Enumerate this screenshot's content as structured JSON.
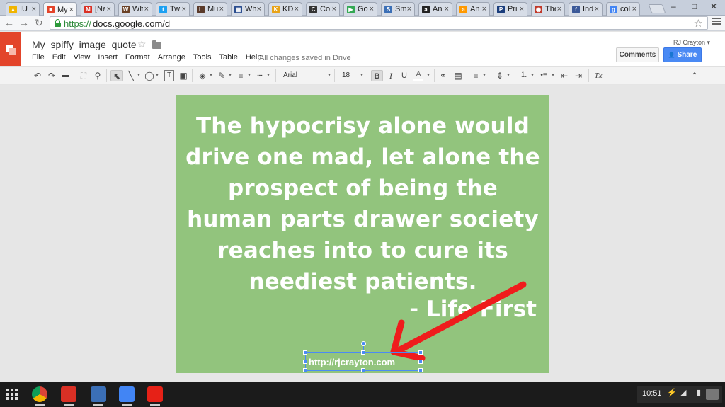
{
  "browser": {
    "tabs": [
      {
        "label": "IU",
        "fav_color": "#f0b400",
        "fav_glyph": "▲"
      },
      {
        "label": "My",
        "fav_color": "#e3442a",
        "fav_glyph": "■",
        "active": true
      },
      {
        "label": "[Ne",
        "fav_color": "#d93025",
        "fav_glyph": "M"
      },
      {
        "label": "Wh",
        "fav_color": "#6b4226",
        "fav_glyph": "W"
      },
      {
        "label": "Tw",
        "fav_color": "#1da1f2",
        "fav_glyph": "t"
      },
      {
        "label": "Mu",
        "fav_color": "#5a3a2a",
        "fav_glyph": "L"
      },
      {
        "label": "Wh",
        "fav_color": "#2a4d8f",
        "fav_glyph": "▦"
      },
      {
        "label": "KD",
        "fav_color": "#e8a317",
        "fav_glyph": "K"
      },
      {
        "label": "Co",
        "fav_color": "#333333",
        "fav_glyph": "C"
      },
      {
        "label": "Go",
        "fav_color": "#34a853",
        "fav_glyph": "▶"
      },
      {
        "label": "Sm",
        "fav_color": "#3b6fb6",
        "fav_glyph": "S"
      },
      {
        "label": "An",
        "fav_color": "#222222",
        "fav_glyph": "a"
      },
      {
        "label": "An",
        "fav_color": "#ff9900",
        "fav_glyph": "a"
      },
      {
        "label": "Pri",
        "fav_color": "#1a3d7c",
        "fav_glyph": "P"
      },
      {
        "label": "The",
        "fav_color": "#c0392b",
        "fav_glyph": "◉"
      },
      {
        "label": "Ind",
        "fav_color": "#3b5998",
        "fav_glyph": "f"
      },
      {
        "label": "col",
        "fav_color": "#4285f4",
        "fav_glyph": "g"
      }
    ],
    "tab_close": "×",
    "url_https": "https://",
    "url_rest": "docs.google.com/d",
    "back": "←",
    "forward": "→",
    "reload": "↻",
    "star": "☆",
    "win_min": "–",
    "win_max": "□",
    "win_close": "✕"
  },
  "doc": {
    "title": "My_spiffy_image_quote",
    "title_star": "☆",
    "menu": [
      "File",
      "Edit",
      "View",
      "Insert",
      "Format",
      "Arrange",
      "Tools",
      "Table",
      "Help"
    ],
    "saved_status": "All changes saved in Drive",
    "user": "RJ Crayton ▾",
    "comments_label": "Comments",
    "share_label": "Share",
    "share_icon": "👤"
  },
  "toolbar": {
    "font": "Arial",
    "font_size": "18",
    "bold": "B",
    "italic": "I",
    "underline": "U",
    "clear_format": "Tx",
    "collapse": "⌃",
    "undo": "↶",
    "redo": "↷",
    "zoom": "⚲",
    "select": "⬉",
    "line": "╲",
    "shape": "◯",
    "textbox": "T",
    "image": "▣",
    "fill": "◈",
    "pen": "✎",
    "weight": "≡",
    "dash": "┅",
    "link": "⚭",
    "comment": "▤",
    "align": "≡",
    "spacing": "⇕",
    "numlist": "⒈",
    "bulllist": "•≡",
    "indent_less": "⇤",
    "indent_more": "⇥",
    "dropdown": "▾"
  },
  "slide": {
    "quote": "The hypocrisy alone would drive one mad, let alone the prospect of being the human parts drawer society reaches into to cure its neediest patients.",
    "author": "- Life First",
    "site": "http://rjcrayton.com",
    "bg_color": "#92c47d",
    "arrow_color": "#ef1c1c",
    "selection_color": "#4a8af4"
  },
  "shelf": {
    "apps": [
      {
        "name": "chrome-icon",
        "color": "#db4437"
      },
      {
        "name": "gmail-icon",
        "color": "#d93025"
      },
      {
        "name": "google-plus-icon",
        "color": "#3b6fb6"
      },
      {
        "name": "docs-icon",
        "color": "#4285f4"
      },
      {
        "name": "youtube-icon",
        "color": "#e62117"
      }
    ],
    "clock": "10:51"
  }
}
